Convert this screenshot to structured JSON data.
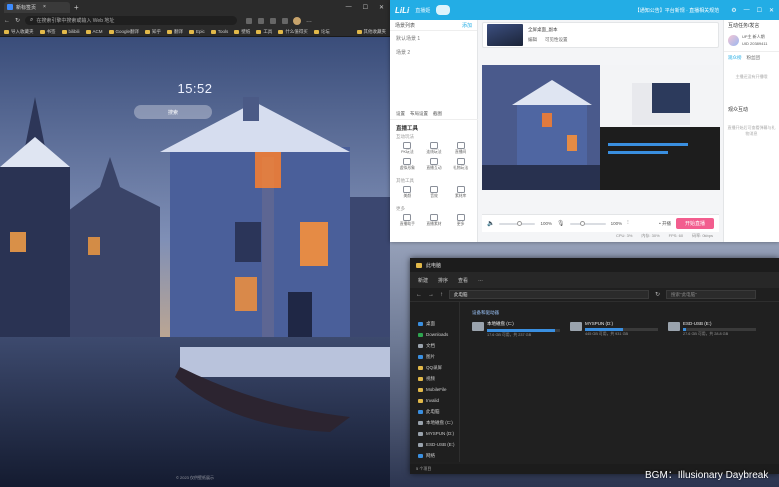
{
  "browser": {
    "tab_title": "新标签页",
    "address_text": "在搜索引擎中搜索或输入 Web 地址",
    "bookmarks": [
      "导入收藏夹",
      "书签",
      "bilibili",
      "ACM",
      "Google翻译",
      "知乎",
      "翻译",
      "Epic",
      "Tools",
      "壁纸",
      "工具",
      "什么值得买",
      "论坛"
    ],
    "bookmarks_right": "其他收藏夹",
    "clock": "15:52",
    "search_label": "搜索",
    "footer": "© 2023 仅供壁纸展示"
  },
  "live": {
    "logo": "LiLi",
    "app_name": "直播姬",
    "notice": "【通知公告】平台新规 · 直播相关规范",
    "scene_header": "场景列表",
    "scene_add": "添加",
    "scenes": [
      "默认场景 1",
      "场景 2"
    ],
    "left_actions": [
      "设置",
      "布局设置",
      "截图"
    ],
    "tools_title": "直播工具",
    "tool_sections": [
      {
        "title": "互动玩法",
        "tools": [
          "PK玩法",
          "连线玩法",
          "直播间",
          "虚拟形象",
          "直播互动",
          "礼物玩法"
        ]
      },
      {
        "title": "其他工具",
        "tools": [
          "美颜",
          "音效",
          "素材库"
        ]
      },
      {
        "title": "更多",
        "tools": [
          "直播助手",
          "直播素材",
          "更多"
        ]
      }
    ],
    "source_name": "全屏桌面_副本",
    "source_buttons": [
      "编辑",
      "可见性设置"
    ],
    "zoom_left": "100%",
    "zoom_right": "100%",
    "more_label": "• 开播",
    "start_button": "开始直播",
    "status": [
      "CPU: 3%",
      "内存: 30%",
      "FPS: 60",
      "码率: 0kbps"
    ],
    "right_title": "互动任务/发言",
    "user_name": "UP主 新人期",
    "user_id": "UID 20389411",
    "right_tabs": [
      "观众榜",
      "粉丝团"
    ],
    "right_empty": "主播还没有开播哦",
    "gift_title": "观众互动",
    "gift_empty": "直播开始后可查看弹幕与礼物消息"
  },
  "explorer": {
    "title": "此电脑",
    "commands": [
      "新建",
      "排序",
      "查看",
      "…"
    ],
    "address": "此电脑",
    "search_placeholder": "搜索\"此电脑\"",
    "sidebar": [
      "桌面",
      "Downloads",
      "文档",
      "图片",
      "QQ录屏",
      "视频",
      "MobileFile",
      "Invalid",
      "此电脑",
      "本地磁盘 (C:)",
      "MYSPUN (D:)",
      "ESD-USB (E:)",
      "网络"
    ],
    "group_title": "设备和驱动器",
    "drives": [
      {
        "name": "本地磁盘 (C:)",
        "free": "17.6 GB 可用，共 237 GB",
        "used_fraction": 0.93
      },
      {
        "name": "MYSPUN (D:)",
        "free": "445 GB 可用，共 931 GB",
        "used_fraction": 0.52
      },
      {
        "name": "ESD-USB (E:)",
        "free": "27.6 GB 可用，共 28.8 GB",
        "used_fraction": 0.04
      }
    ],
    "status": "5 个项目"
  },
  "overlay": {
    "bgm": "BGM：Illusionary Daybreak"
  },
  "colors": {
    "bili_blue": "#23ade5",
    "bili_pink": "#f25d8e",
    "drive_blue": "#3a8fe0"
  }
}
